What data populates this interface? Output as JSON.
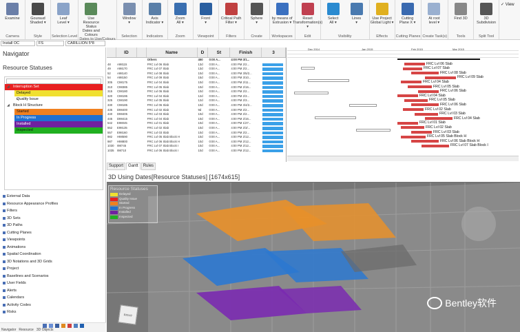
{
  "ribbon": {
    "groups": [
      {
        "name": "Camera",
        "buttons": [
          {
            "label": "Examine",
            "icon": "camera-icon",
            "color": "#6b7fa8"
          }
        ]
      },
      {
        "name": "Style",
        "buttons": [
          {
            "label": "Gouraud\nShaded ▾",
            "icon": "sphere-icon",
            "color": "#4a4a4a"
          }
        ]
      },
      {
        "name": "Selection Level",
        "buttons": [
          {
            "label": "Leaf\nLevel ▾",
            "icon": "leaf-icon",
            "color": "#8aa3c8"
          }
        ]
      },
      {
        "name": "Dates to Use/Colours",
        "buttons": [
          {
            "label": "Use Resource Status\nDates and Colours",
            "icon": "colours-icon",
            "color": "#5a8a5a"
          }
        ]
      },
      {
        "name": "Selection",
        "buttons": [
          {
            "label": "Window\n▾",
            "icon": "window-icon",
            "color": "#7a8fb0"
          }
        ]
      },
      {
        "name": "Indicators",
        "buttons": [
          {
            "label": "Axis\nIndicator ▾",
            "icon": "axis-icon",
            "color": "#5a7fa8"
          }
        ]
      },
      {
        "name": "Zoom",
        "buttons": [
          {
            "label": "Zoom\nAll ▾",
            "icon": "zoom-icon",
            "color": "#3a6fb0"
          }
        ]
      },
      {
        "name": "Viewpoint",
        "buttons": [
          {
            "label": "Front\n▾",
            "icon": "cube-icon",
            "color": "#2a5fa0"
          }
        ]
      },
      {
        "name": "Filters",
        "buttons": [
          {
            "label": "Critical Path\nFilter ▾",
            "icon": "critical-path-icon",
            "color": "#c04040"
          }
        ]
      },
      {
        "name": "Create",
        "buttons": [
          {
            "label": "Sphere\n▾",
            "icon": "sphere-icon",
            "color": "#555555"
          }
        ]
      },
      {
        "name": "Workspaces",
        "buttons": [
          {
            "label": "by means of\nExtrusion ▾",
            "icon": "extrusion-icon",
            "color": "#3a70c0"
          }
        ]
      },
      {
        "name": "Edit",
        "buttons": [
          {
            "label": "Reset\nTransformation(s) ▾",
            "icon": "reset-icon",
            "color": "#c04050"
          }
        ]
      },
      {
        "name": "Visibility",
        "buttons": [
          {
            "label": "Select\nAll ▾",
            "icon": "select-all-icon",
            "color": "#2a8ad0"
          },
          {
            "label": "Lines\n▾",
            "icon": "lines-icon",
            "color": "#4a7ab0"
          }
        ]
      },
      {
        "name": "Effects",
        "buttons": [
          {
            "label": "Use Project\nGlobal Light ▾",
            "icon": "light-icon",
            "color": "#e0b020"
          }
        ]
      },
      {
        "name": "Cutting Planes",
        "buttons": [
          {
            "label": "Cutting\nPlane X ▾",
            "icon": "cutting-plane-icon",
            "color": "#3a6ab0"
          }
        ]
      },
      {
        "name": "Create Task(s)",
        "buttons": [
          {
            "label": "At root\nlevel ▾",
            "icon": "task-icon",
            "color": "#9ab0d0"
          }
        ]
      },
      {
        "name": "Tools",
        "buttons": [
          {
            "label": "Find 3D",
            "icon": "find-3d-icon",
            "color": "#888888"
          }
        ]
      },
      {
        "name": "Split Tool",
        "buttons": [
          {
            "label": "3D\nSubdivision",
            "icon": "subdivision-icon",
            "color": "#555555"
          }
        ]
      }
    ],
    "view_label": "✓ View"
  },
  "selection_row": {
    "field1": "Install OC",
    "field2": "FS",
    "field3": "CARILLION 5*8"
  },
  "navigator": {
    "title": "Navigator",
    "section": "Resource Statuses",
    "tree": [
      {
        "label": "Interruption Set",
        "color": "#e82020",
        "level": 0,
        "expanded": true
      },
      {
        "label": "Delayed",
        "color": "#f0e030",
        "level": 1
      },
      {
        "label": "Quality Issue",
        "color": "#ffffff",
        "level": 1,
        "collapsed": true
      },
      {
        "label": "Block H Structure",
        "color": "#ffffff",
        "level": 0,
        "expanded": true
      },
      {
        "label": "Started",
        "color": "#f08020",
        "level": 1
      },
      {
        "label": "In Progress",
        "color": "#2070d0",
        "level": 1
      },
      {
        "label": "Installed",
        "color": "#7020a0",
        "level": 1
      },
      {
        "label": "Inspected",
        "color": "#20b020",
        "level": 1
      }
    ],
    "workspace_items": [
      "External Data",
      "Resource Appearance Profiles",
      "Filters",
      "3D Sets",
      "3D Paths",
      "Cutting Planes",
      "Viewpoints",
      "Animations",
      "Spatial Coordination",
      "3D Notations and 3D Grids",
      "Project",
      "Baselines and Scenarios",
      "User Fields",
      "Alerts",
      "Calendars",
      "Activity Codes",
      "Risks"
    ],
    "bottom_tabs": [
      "Navigator",
      "Resource",
      "3D Objects"
    ]
  },
  "gantt": {
    "columns": {
      "id": "ID",
      "name": "Name",
      "dur": "D",
      "start": "St",
      "finish": "Finish",
      "extra": "3"
    },
    "rows": [
      {
        "rn": "",
        "id": "",
        "name": "Others",
        "dur": "450",
        "start": "0:00 A...",
        "finish": "4:00 PM 3/1..."
      },
      {
        "rn": "48",
        "id": "A98115",
        "name": "FRC Lvl 06 Slab",
        "dur": "13d",
        "start": "0:00 A...",
        "finish": "4:00 PM 2/2..."
      },
      {
        "rn": "49",
        "id": "A98170",
        "name": "FRC Lvl 07 Slab",
        "dur": "13d",
        "start": "0:00 A...",
        "finish": "4:00 PM 2/2..."
      },
      {
        "rn": "52",
        "id": "A98140",
        "name": "FRC Lvl 08 Slab",
        "dur": "10d",
        "start": "0:00 A...",
        "finish": "4:00 PM 3/5/2..."
      },
      {
        "rn": "54",
        "id": "A98150",
        "name": "FRC Lvl 09 Slab",
        "dur": "15d",
        "start": "0:00 A...",
        "finish": "4:00 PM 3/10..."
      },
      {
        "rn": "305",
        "id": "C98175",
        "name": "FRC Lvl 04 Slab",
        "dur": "10d",
        "start": "0:00 A...",
        "finish": "4:00 PM 2/11..."
      },
      {
        "rn": "310",
        "id": "C98385",
        "name": "FRC Lvl 05 Slab",
        "dur": "10d",
        "start": "0:00 A...",
        "finish": "4:00 PM 2/16..."
      },
      {
        "rn": "315",
        "id": "C98180",
        "name": "FRC Lvl 06 Slab",
        "dur": "10d",
        "start": "0:00 A...",
        "finish": "4:00 PM 2/2..."
      },
      {
        "rn": "320",
        "id": "C98195",
        "name": "FRC Lvl 04 Slab",
        "dur": "12d",
        "start": "0:00 A...",
        "finish": "4:00 PM 2/3..."
      },
      {
        "rn": "325",
        "id": "C98190",
        "name": "FRC Lvl 05 Slab",
        "dur": "12d",
        "start": "0:00 A...",
        "finish": "4:00 PM 2/3..."
      },
      {
        "rn": "330",
        "id": "C98185",
        "name": "FRC Lvl 06 Slab",
        "dur": "10d",
        "start": "0:00 A...",
        "finish": "4:00 PM 3/4/2..."
      },
      {
        "rn": "435",
        "id": "D98400",
        "name": "FRC Lvl 02 Slab",
        "dur": "9d",
        "start": "0:00 A...",
        "finish": "4:00 PM 2/2..."
      },
      {
        "rn": "440",
        "id": "D98405",
        "name": "FRC Lvl 03 Slab",
        "dur": "10d",
        "start": "0:00 A...",
        "finish": "4:00 PM 2/2..."
      },
      {
        "rn": "445",
        "id": "D98415",
        "name": "FRC Lvl 04 Slab",
        "dur": "10d",
        "start": "0:00 A...",
        "finish": "4:00 PM 2/16..."
      },
      {
        "rn": "542",
        "id": "E98045",
        "name": "FRC Lvl 01 Slab",
        "dur": "10d",
        "start": "0:00 A...",
        "finish": "4:00 PM 1/27..."
      },
      {
        "rn": "552",
        "id": "E98135",
        "name": "FRC Lvl 02 Slab",
        "dur": "10d",
        "start": "0:00 A...",
        "finish": "4:00 PM 2/3/..."
      },
      {
        "rn": "557",
        "id": "E98160",
        "name": "FRC Lvl 03 Slab",
        "dur": "10d",
        "start": "0:00 A...",
        "finish": "4:00 PM 2/2..."
      },
      {
        "rn": "982",
        "id": "H98590",
        "name": "FRC Lvl 05 Slab Block H",
        "dur": "10d",
        "start": "0:00 A...",
        "finish": "4:00 PM 2/12..."
      },
      {
        "rn": "987",
        "id": "H98800",
        "name": "FRC Lvl 06 Slab Block H",
        "dur": "10d",
        "start": "0:00 A...",
        "finish": "4:00 PM 2/12..."
      },
      {
        "rn": "1030",
        "id": "I98745",
        "name": "FRC Lvl 07 Slab Block I",
        "dur": "10d",
        "start": "0:00 A...",
        "finish": "4:00 PM 2/12..."
      },
      {
        "rn": "1035",
        "id": "I98710",
        "name": "FRC Lvl 06 Slab Block I",
        "dur": "10d",
        "start": "0:00 A...",
        "finish": "4:00 PM 2/12..."
      }
    ],
    "timeline_months": [
      "Dec 2014",
      "Jan 2015",
      "Feb 2015",
      "Mar 2015"
    ],
    "bar_labels": [
      "FRC Lvl 06 Slab",
      "FRC Lvl 07 Slab",
      "FRC Lvl 08 Slab",
      "FRC Lvl 09 Slab",
      "FRC Lvl 04 Slab",
      "FRC Lvl 05 Slab",
      "FRC Lvl 06 Slab",
      "FRC Lvl 04 Slab",
      "FRC Lvl 05 Slab",
      "FRC Lvl 06 Slab",
      "FRC Lvl 02 Slab",
      "FRC Lvl 03 Slab",
      "FRC Lvl 04 Slab",
      "FRC Lvl 01 Slab",
      "FRC Lvl 02 Slab",
      "FRC Lvl 03 Slab",
      "FRC Lvl 05 Slab Block H",
      "FRC Lvl 06 Slab Block H",
      "FRC Lvl 07 Slab Block I"
    ],
    "tabs": [
      "Support",
      "Gantt",
      "Rules"
    ],
    "active_tab": "Gantt"
  },
  "view3d": {
    "title": "3D Using Dates[Resource Statuses] [1674x615]",
    "legend_title": "Resource Statuses",
    "legend": [
      {
        "label": "Delayed",
        "color": "#f0e030"
      },
      {
        "label": "Quality Issue",
        "color": "#e82020"
      },
      {
        "label": "Started",
        "color": "#f08020"
      },
      {
        "label": "In Progress",
        "color": "#2070d0"
      },
      {
        "label": "Installed",
        "color": "#7020a0"
      },
      {
        "label": "Inspected",
        "color": "#20b020"
      }
    ],
    "watermark": "Bentley软件",
    "cube_labels": [
      "RIGHT",
      "BACK"
    ]
  },
  "colors": {
    "accent": "#3aa0e8",
    "bar_red": "#d64545",
    "ribbon_bg": "#f7f7f7"
  }
}
